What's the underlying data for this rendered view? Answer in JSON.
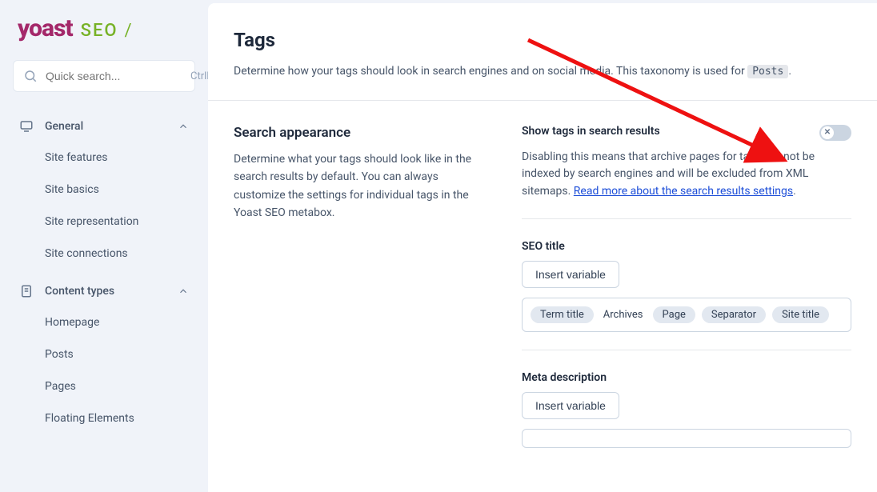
{
  "logo": {
    "brand": "yoast",
    "suffix": "SEO",
    "slash": "/"
  },
  "search": {
    "placeholder": "Quick search...",
    "shortcut": "CtrlK"
  },
  "sidebar": {
    "groups": [
      {
        "label": "General",
        "items": [
          "Site features",
          "Site basics",
          "Site representation",
          "Site connections"
        ]
      },
      {
        "label": "Content types",
        "items": [
          "Homepage",
          "Posts",
          "Pages",
          "Floating Elements"
        ]
      }
    ]
  },
  "page": {
    "title": "Tags",
    "desc_pre": "Determine how your tags should look in search engines and on social media. This taxonomy is used for ",
    "desc_pill": "Posts",
    "desc_post": "."
  },
  "section": {
    "title": "Search appearance",
    "desc": "Determine what your tags should look like in the search results by default. You can always customize the settings for individual tags in the Yoast SEO metabox."
  },
  "toggle": {
    "label": "Show tags in search results",
    "help_pre": "Disabling this means that archive pages for tags will not be indexed by search engines and will be excluded from XML sitemaps. ",
    "help_link": "Read more about the search results settings",
    "help_post": "."
  },
  "seo_title": {
    "label": "SEO title",
    "insert_btn": "Insert variable",
    "chips": [
      {
        "text": "Term title",
        "type": "chip"
      },
      {
        "text": "Archives",
        "type": "plain"
      },
      {
        "text": "Page",
        "type": "chip"
      },
      {
        "text": "Separator",
        "type": "chip"
      },
      {
        "text": "Site title",
        "type": "chip"
      }
    ]
  },
  "meta_desc": {
    "label": "Meta description",
    "insert_btn": "Insert variable"
  }
}
